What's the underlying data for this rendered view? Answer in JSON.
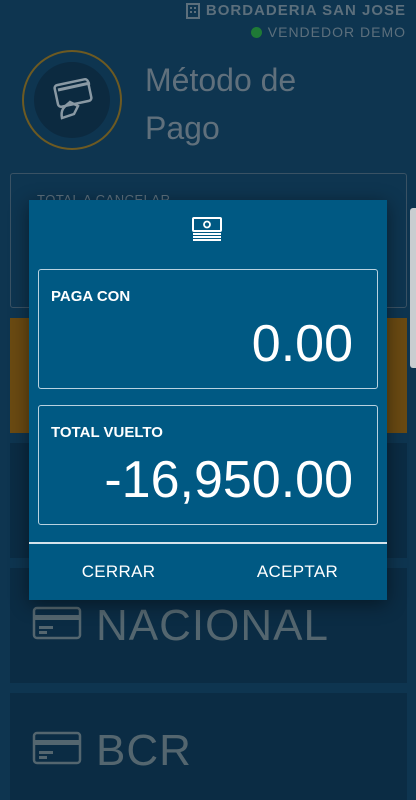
{
  "header": {
    "store_name": "BORDADERIA SAN JOSE",
    "seller": "VENDEDOR DEMO",
    "title": "Método de Pago"
  },
  "total_box": {
    "label": "TOTAL A CANCELAR"
  },
  "methods": [
    {
      "name": "NACIONAL",
      "icon": "credit-card-icon"
    },
    {
      "name": "BCR",
      "icon": "credit-card-icon"
    }
  ],
  "dialog": {
    "icon": "cash-icon",
    "pay_with": {
      "label": "PAGA CON",
      "value": "0.00"
    },
    "change": {
      "label": "TOTAL VUELTO",
      "value": "-16,950.00"
    },
    "close_label": "CERRAR",
    "accept_label": "ACEPTAR"
  },
  "colors": {
    "background": "#0e3550",
    "dialog": "#005983",
    "accent_orange": "#6a4a12",
    "online": "#1f7a36"
  }
}
